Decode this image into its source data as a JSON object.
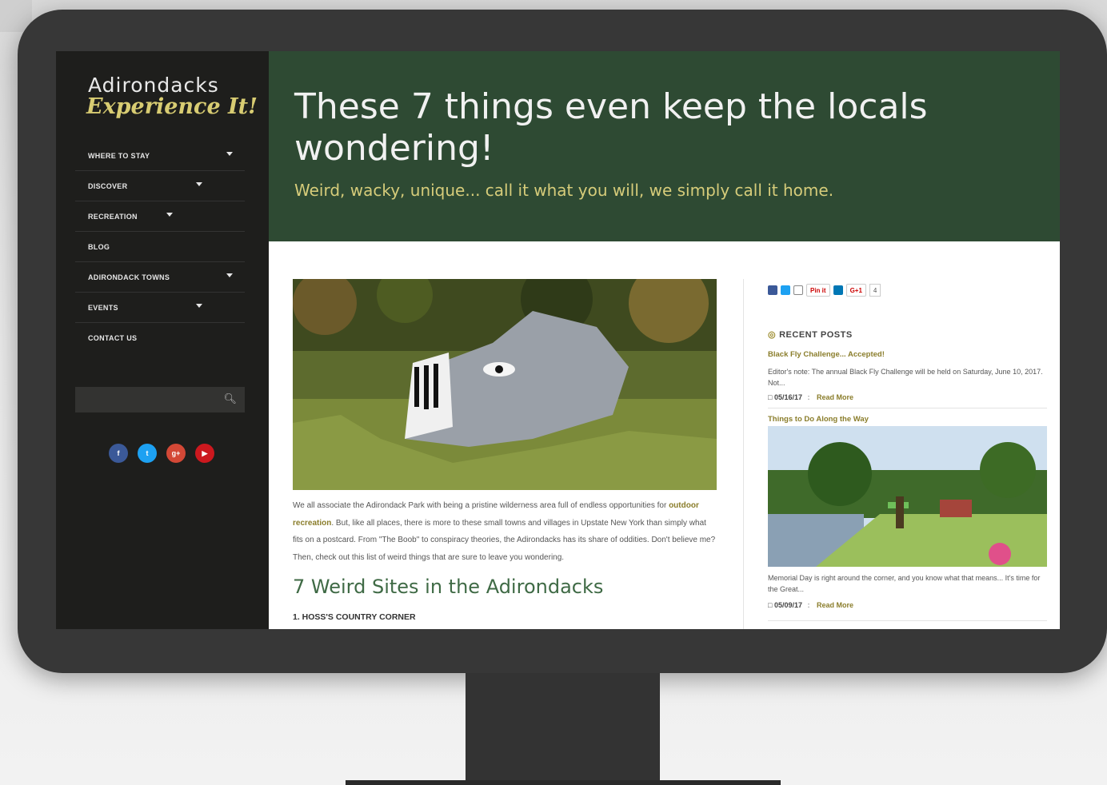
{
  "logo": {
    "line1": "Adirondacks",
    "line2": "Experience It!"
  },
  "nav": [
    {
      "label": "WHERE TO STAY",
      "has_caret": true
    },
    {
      "label": "DISCOVER",
      "has_caret": true
    },
    {
      "label": "RECREATION",
      "has_caret": true
    },
    {
      "label": "BLOG",
      "has_caret": false
    },
    {
      "label": "ADIRONDACK TOWNS",
      "has_caret": true
    },
    {
      "label": "EVENTS",
      "has_caret": true
    },
    {
      "label": "CONTACT US",
      "has_caret": false
    }
  ],
  "search": {
    "placeholder": ""
  },
  "social": [
    {
      "name": "facebook-icon",
      "glyph": "f",
      "color": "#3b5998"
    },
    {
      "name": "twitter-icon",
      "glyph": "t",
      "color": "#1da1f2"
    },
    {
      "name": "googleplus-icon",
      "glyph": "g+",
      "color": "#d34836"
    },
    {
      "name": "youtube-icon",
      "glyph": "▶",
      "color": "#cc181e"
    }
  ],
  "hero": {
    "title": "These 7 things even keep the locals wondering!",
    "subtitle": "Weird, wacky, unique... call it what you will, we simply call it home."
  },
  "article": {
    "p_before": "We all associate the Adirondack Park with being a pristine wilderness area full of endless opportunities for ",
    "link": "outdoor recreation",
    "p_after": ". But, like all places, there is more to these small towns and villages in Upstate New York than simply what fits on a postcard. From \"The Boob\" to conspiracy theories, the Adirondacks has its share of oddities. Don't believe me? Then, check out this list of weird things that are sure to leave you wondering.",
    "heading": "7 Weird Sites in the Adirondacks",
    "subheading": "1. HOSS'S COUNTRY CORNER"
  },
  "share": {
    "pinit": "Pin it",
    "gplus": "G+1",
    "count": "4"
  },
  "recent_posts": {
    "heading": "RECENT POSTS",
    "posts": [
      {
        "title": "Black Fly Challenge... Accepted!",
        "excerpt": "Editor's note: The annual Black Fly Challenge will be held on Saturday, June 10, 2017. Not...",
        "date": "05/16/17",
        "sep": ":",
        "read_more": "Read More"
      },
      {
        "title": "Things to Do Along the Way",
        "excerpt": "Memorial Day is right around the corner, and you know what that means... It's time for the Great...",
        "date": "05/09/17",
        "sep": ":",
        "read_more": "Read More"
      }
    ]
  },
  "colors": {
    "sidebar": "#1e1e1c",
    "hero": "#2e4a33",
    "accent": "#d6cc7a",
    "link": "#8a7d2b"
  }
}
